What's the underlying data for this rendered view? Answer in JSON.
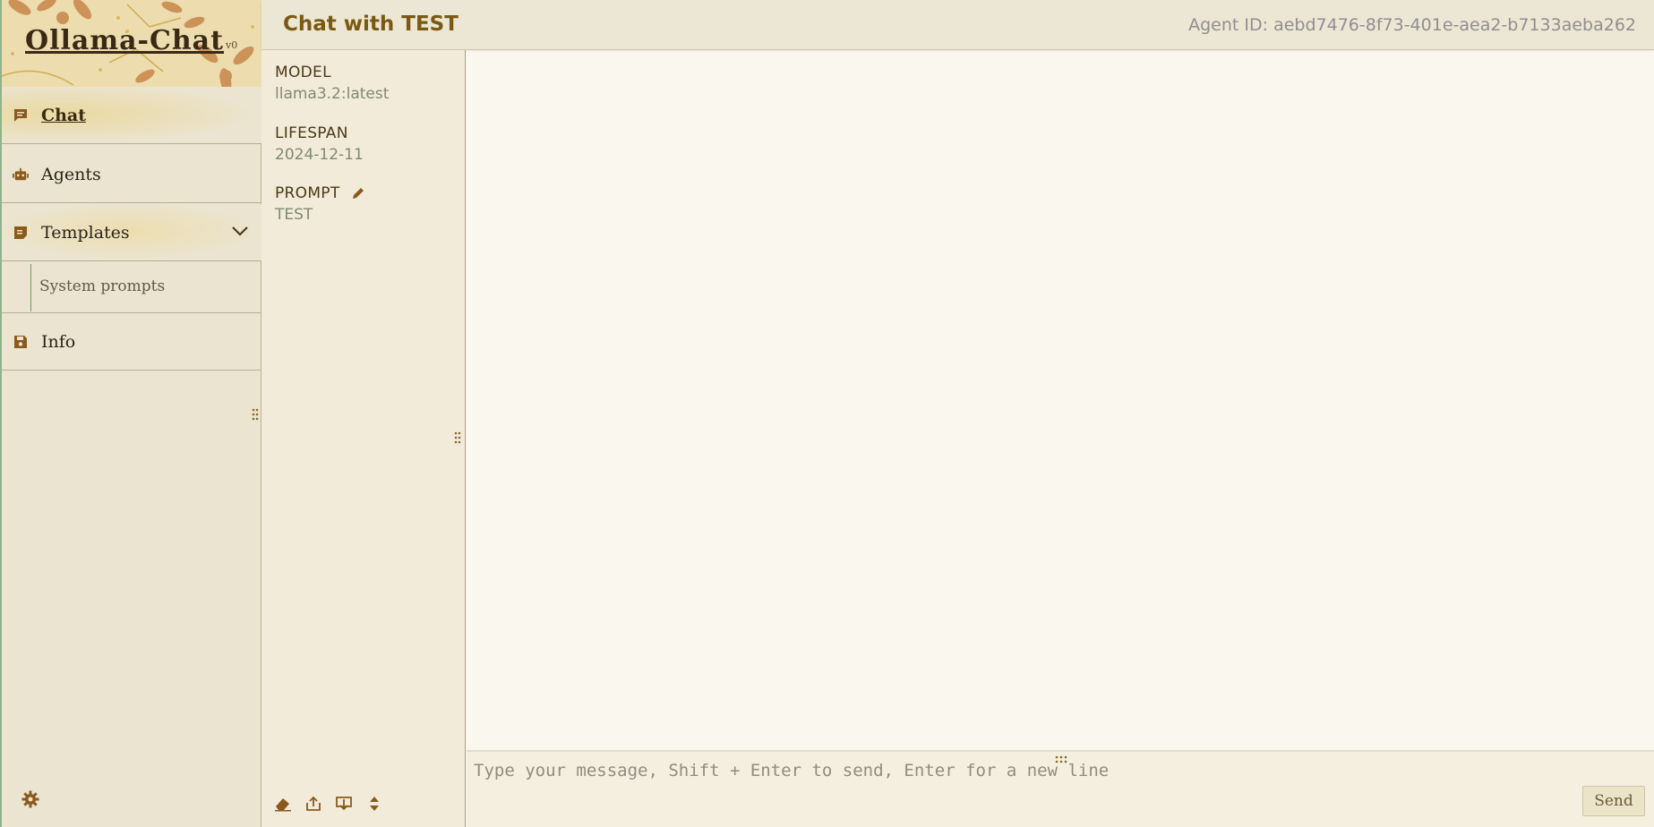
{
  "app": {
    "name": "Ollama-Chat",
    "version": "v0"
  },
  "sidebar": {
    "items": [
      {
        "label": "Chat",
        "icon": "message-icon",
        "active": true
      },
      {
        "label": "Agents",
        "icon": "robot-icon"
      },
      {
        "label": "Templates",
        "icon": "template-icon",
        "expanded": true
      },
      {
        "label": "Info",
        "icon": "save-icon"
      }
    ],
    "subitems": [
      {
        "label": "System prompts"
      }
    ]
  },
  "header": {
    "title": "Chat with TEST",
    "agent_id": "Agent ID: aebd7476-8f73-401e-aea2-b7133aeba262"
  },
  "agent_info": {
    "model_label": "MODEL",
    "model_value": "llama3.2:latest",
    "lifespan_label": "LIFESPAN",
    "lifespan_value": "2024-12-11",
    "prompt_label": "PROMPT",
    "prompt_value": "TEST"
  },
  "composer": {
    "placeholder": "Type your message, Shift + Enter to send, Enter for a new line",
    "send_label": "Send"
  },
  "colors": {
    "accent": "#7a5a12",
    "sidebar_bg": "#ebe4d0",
    "chat_bg": "#faf7ee"
  }
}
